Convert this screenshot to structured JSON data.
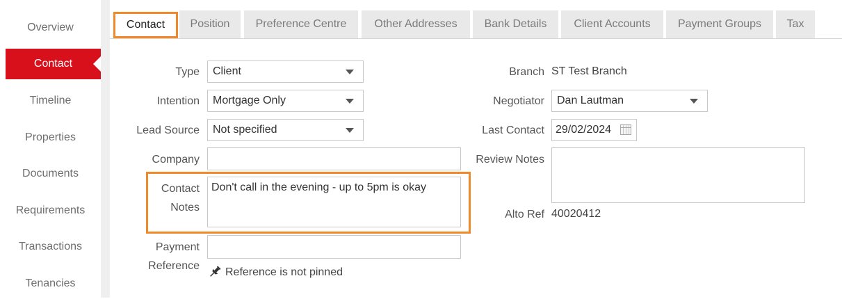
{
  "sidebar": {
    "items": [
      {
        "label": "Overview"
      },
      {
        "label": "Contact"
      },
      {
        "label": "Timeline"
      },
      {
        "label": "Properties"
      },
      {
        "label": "Documents"
      },
      {
        "label": "Requirements"
      },
      {
        "label": "Transactions"
      },
      {
        "label": "Tenancies"
      }
    ],
    "active": "Contact"
  },
  "tabs": [
    {
      "label": "Contact"
    },
    {
      "label": "Position"
    },
    {
      "label": "Preference Centre"
    },
    {
      "label": "Other Addresses"
    },
    {
      "label": "Bank Details"
    },
    {
      "label": "Client Accounts"
    },
    {
      "label": "Payment Groups"
    },
    {
      "label": "Tax"
    }
  ],
  "form": {
    "type": {
      "label": "Type",
      "value": "Client"
    },
    "intention": {
      "label": "Intention",
      "value": "Mortgage Only"
    },
    "lead_source": {
      "label": "Lead Source",
      "value": "Not specified"
    },
    "company": {
      "label": "Company",
      "value": ""
    },
    "contact_notes": {
      "label_line1": "Contact",
      "label_line2": "Notes",
      "value": "Don't call in the evening - up to 5pm is okay"
    },
    "payment_reference": {
      "label_line1": "Payment",
      "label_line2": "Reference",
      "value": "",
      "pin_status": "Reference is not pinned"
    },
    "branch": {
      "label": "Branch",
      "value": "ST Test Branch"
    },
    "negotiator": {
      "label": "Negotiator",
      "value": "Dan Lautman"
    },
    "last_contact": {
      "label": "Last Contact",
      "value": "29/02/2024"
    },
    "review_notes": {
      "label": "Review Notes",
      "value": ""
    },
    "alto_ref": {
      "label": "Alto Ref",
      "value": "40020412"
    }
  },
  "colors": {
    "accent_red": "#d8101c",
    "highlight_orange": "#f0892a"
  }
}
